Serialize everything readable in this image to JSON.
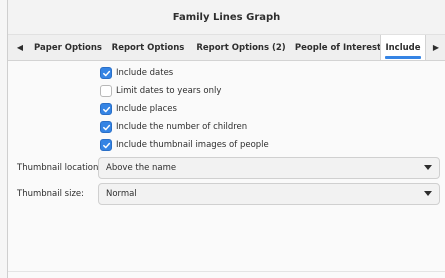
{
  "dialog": {
    "title": "Family Lines Graph"
  },
  "tabs": {
    "items": [
      {
        "label": "Paper Options",
        "active": false
      },
      {
        "label": "Report Options",
        "active": false
      },
      {
        "label": "Report Options (2)",
        "active": false
      },
      {
        "label": "People of Interest",
        "active": false
      },
      {
        "label": "Include",
        "active": true
      }
    ],
    "prev_icon": "left-triangle-icon",
    "next_icon": "right-triangle-icon"
  },
  "include": {
    "options": [
      {
        "label": "Include dates",
        "checked": true
      },
      {
        "label": "Limit dates to years only",
        "checked": false
      },
      {
        "label": "Include places",
        "checked": true
      },
      {
        "label": "Include the number of children",
        "checked": true
      },
      {
        "label": "Include thumbnail images of people",
        "checked": true
      }
    ],
    "thumbnail_location": {
      "label": "Thumbnail location:",
      "value": "Above the name"
    },
    "thumbnail_size": {
      "label": "Thumbnail size:",
      "value": "Normal"
    }
  },
  "colors": {
    "accent": "#3584e4",
    "checkbox_border": "#b8b8b8",
    "tab_bar": "#efefef"
  }
}
